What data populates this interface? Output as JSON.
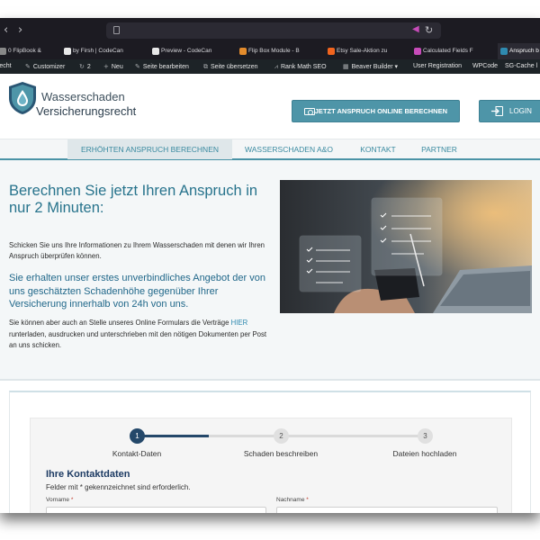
{
  "browser": {
    "tabs": [
      {
        "title": "0 FlipBook &",
        "favicon_color": "#888888"
      },
      {
        "title": "by Firsh | CodeCan",
        "favicon_color": "#e8e8e8"
      },
      {
        "title": "Preview - CodeCan",
        "favicon_color": "#e8e8e8"
      },
      {
        "title": "Flip Box Module - B",
        "favicon_color": "#e38b2c"
      },
      {
        "title": "Etsy Sale-Aktion zu",
        "favicon_color": "#f1641e"
      },
      {
        "title": "Calculated Fields F",
        "favicon_color": "#c74bb9"
      },
      {
        "title": "Anspruch b",
        "favicon_color": "#2f8ab0"
      }
    ]
  },
  "adminbar": {
    "items": [
      {
        "label": "recht",
        "icon": ""
      },
      {
        "label": "Customizer",
        "icon": "brush-icon"
      },
      {
        "label": "2",
        "icon": "refresh-icon"
      },
      {
        "label": "Neu",
        "icon": "plus-icon"
      },
      {
        "label": "Seite bearbeiten",
        "icon": "pencil-icon"
      },
      {
        "label": "Seite übersetzen",
        "icon": "translate-icon"
      },
      {
        "label": "Rank Math SEO",
        "icon": "chart-icon"
      },
      {
        "label": "Beaver Builder ▾",
        "icon": "grid-icon"
      },
      {
        "label": "User Registration",
        "icon": ""
      },
      {
        "label": "WPCode",
        "icon": ""
      },
      {
        "label": "SG-Cache l",
        "icon": ""
      }
    ]
  },
  "header": {
    "logo_line1": "Wasserschaden",
    "logo_line2": "Versicherungsrecht",
    "cta_label": "JETZT ANSPRUCH ONLINE BERECHNEN",
    "login_label": "LOGIN"
  },
  "nav": {
    "items": [
      {
        "label": "ERHÖHTEN ANSPRUCH BERECHNEN",
        "active": true
      },
      {
        "label": "WASSERSCHADEN A&O",
        "active": false
      },
      {
        "label": "KONTAKT",
        "active": false
      },
      {
        "label": "PARTNER",
        "active": false
      }
    ]
  },
  "hero": {
    "title": "Berechnen Sie jetzt Ihren Anspruch in nur 2 Minuten:",
    "intro": "Schicken Sie uns Ihre Informationen zu Ihrem Wasserschaden mit denen wir Ihren Anspruch überprüfen können.",
    "offer": "Sie erhalten unser erstes unverbindliches Angebot der von uns geschätzten Schadenhöhe gegenüber Ihrer Versicherung innerhalb von 24h von uns.",
    "postal_before": "Sie können aber auch an Stelle unseres Online Formulars die Verträge ",
    "postal_link": "HIER",
    "postal_after": " runterladen, ausdrucken und unterschrieben mit den nötigen Dokumenten per Post an uns schicken."
  },
  "form": {
    "steps": [
      {
        "number": "1",
        "label": "Kontakt-Daten",
        "active": true
      },
      {
        "number": "2",
        "label": "Schaden beschreiben",
        "active": false
      },
      {
        "number": "3",
        "label": "Dateien hochladen",
        "active": false
      }
    ],
    "progress_fraction": 0.25,
    "heading": "Ihre Kontaktdaten",
    "note": "Felder mit * gekennzeichnet sind erforderlich.",
    "fields": [
      {
        "label": "Vorname",
        "required_mark": "*",
        "value": ""
      },
      {
        "label": "Nachname",
        "required_mark": "*",
        "value": ""
      }
    ]
  },
  "colors": {
    "accent": "#4e95a8",
    "heading_blue": "#27738c",
    "step_active": "#24486a"
  }
}
